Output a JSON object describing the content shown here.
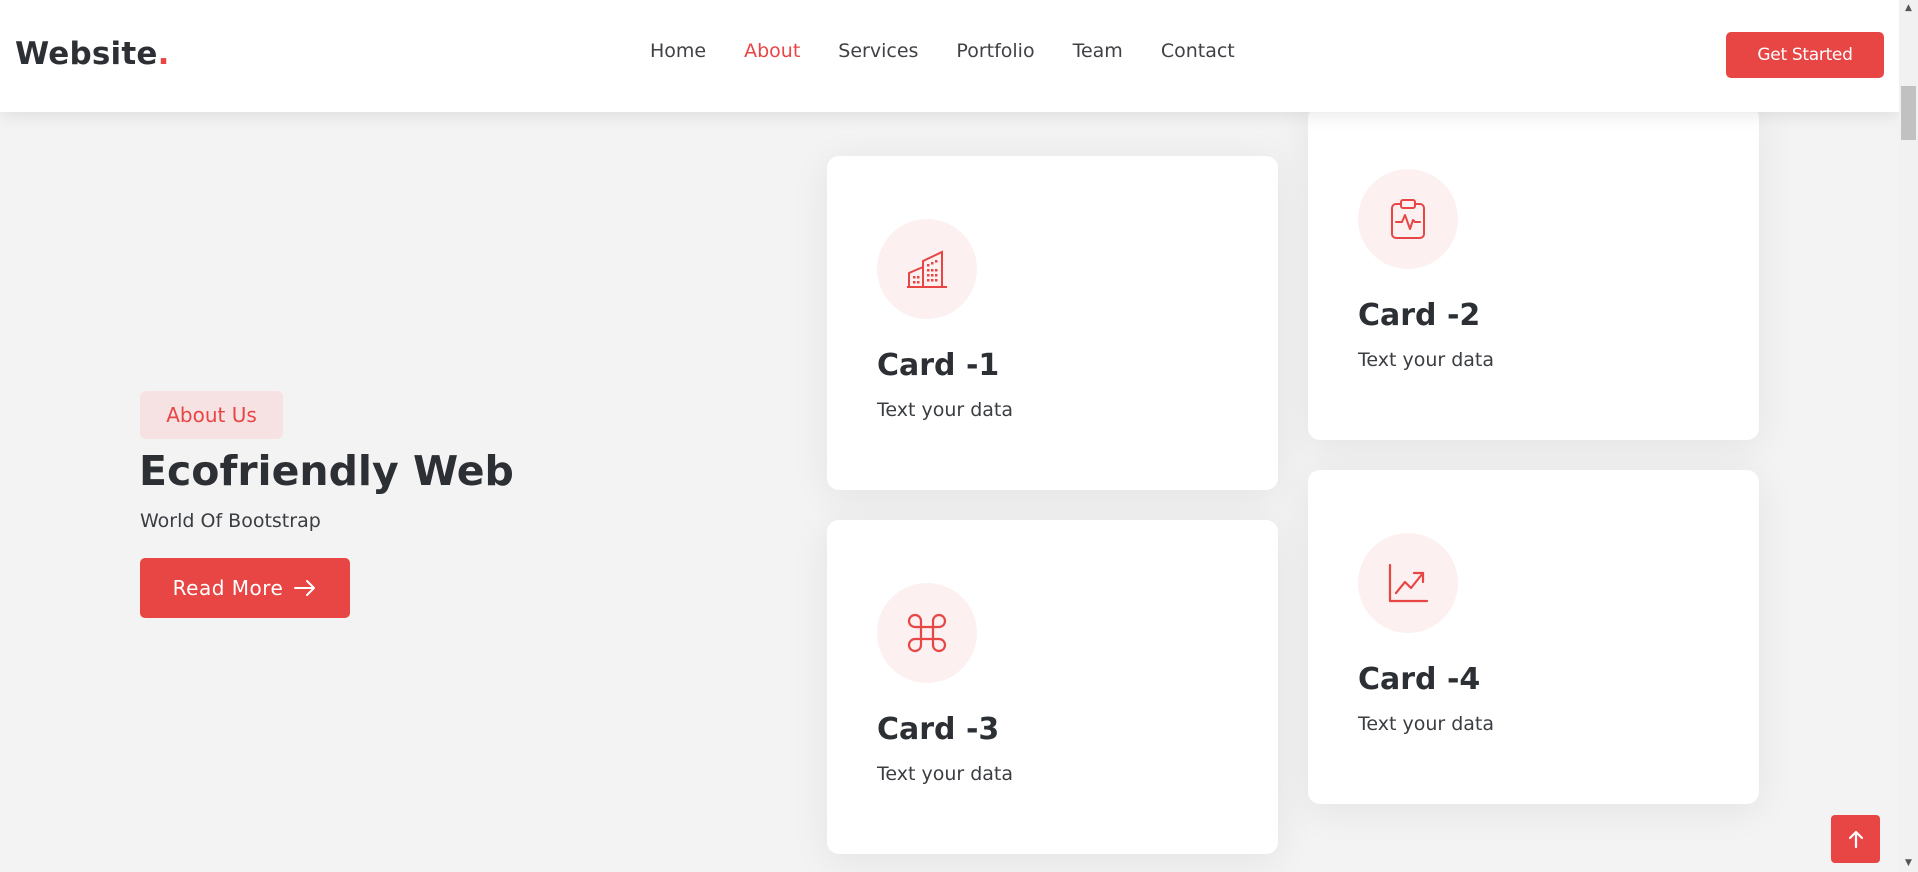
{
  "header": {
    "logo_text": "Website",
    "logo_dot": ".",
    "nav": [
      {
        "label": "Home",
        "active": false
      },
      {
        "label": "About",
        "active": true
      },
      {
        "label": "Services",
        "active": false
      },
      {
        "label": "Portfolio",
        "active": false
      },
      {
        "label": "Team",
        "active": false
      },
      {
        "label": "Contact",
        "active": false
      }
    ],
    "cta_label": "Get Started"
  },
  "hero": {
    "badge": "About Us",
    "title": "Ecofriendly Web",
    "subtitle": "World Of Bootstrap",
    "button_label": "Read More",
    "button_icon": "arrow-right-icon"
  },
  "cards": [
    {
      "title": "Card -1",
      "text": "Text your data",
      "icon": "buildings-icon"
    },
    {
      "title": "Card -2",
      "text": "Text your data",
      "icon": "clipboard-pulse-icon"
    },
    {
      "title": "Card -3",
      "text": "Text your data",
      "icon": "command-icon"
    },
    {
      "title": "Card -4",
      "text": "Text your data",
      "icon": "graph-up-arrow-icon"
    }
  ],
  "colors": {
    "accent": "#e84545",
    "background": "#f4f3f3",
    "text": "#2c2f33",
    "icon_bg": "#fcf0f0"
  }
}
